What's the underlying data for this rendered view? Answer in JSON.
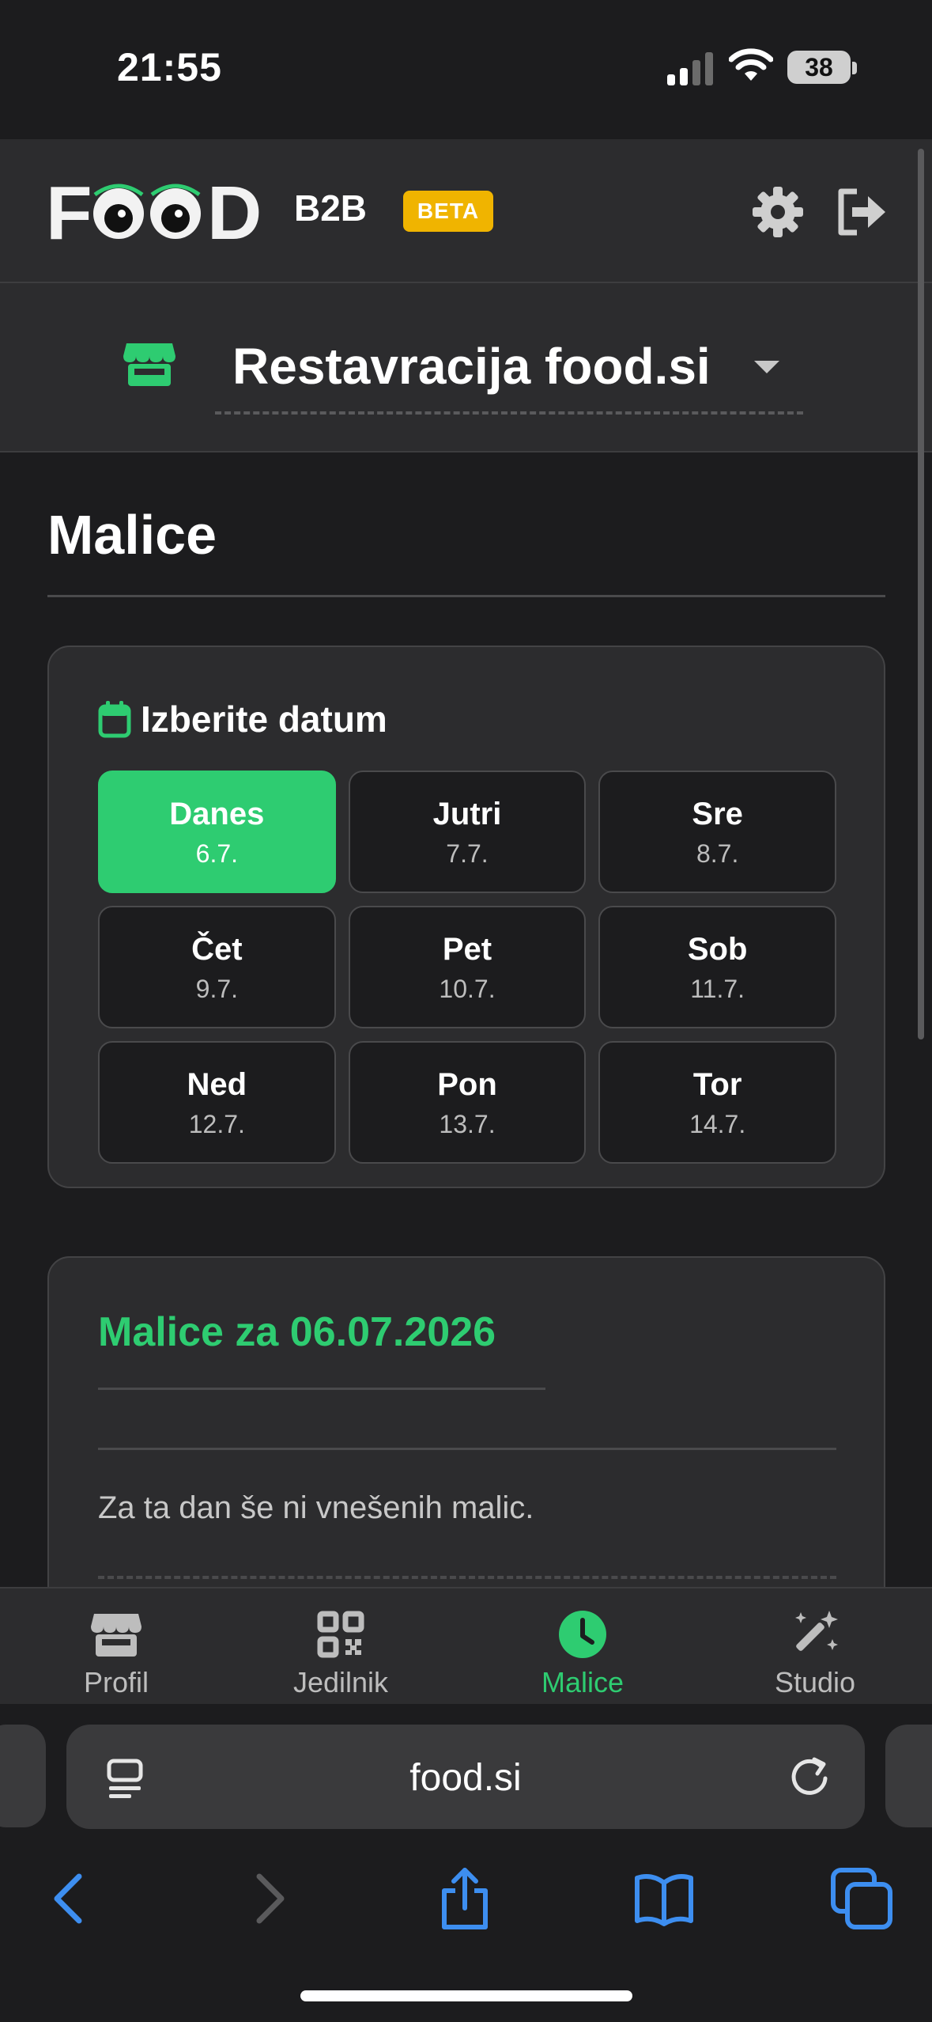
{
  "status_bar": {
    "time": "21:55",
    "battery": "38"
  },
  "header": {
    "brand": "FOOD",
    "suffix": "B2B",
    "badge": "BETA"
  },
  "restaurant": {
    "name": "Restavracija food.si"
  },
  "page": {
    "title": "Malice"
  },
  "date_picker": {
    "title": "Izberite datum",
    "dates": [
      {
        "day": "Danes",
        "date": "6.7.",
        "selected": true
      },
      {
        "day": "Jutri",
        "date": "7.7."
      },
      {
        "day": "Sre",
        "date": "8.7."
      },
      {
        "day": "Čet",
        "date": "9.7."
      },
      {
        "day": "Pet",
        "date": "10.7."
      },
      {
        "day": "Sob",
        "date": "11.7."
      },
      {
        "day": "Ned",
        "date": "12.7."
      },
      {
        "day": "Pon",
        "date": "13.7."
      },
      {
        "day": "Tor",
        "date": "14.7."
      }
    ]
  },
  "meals": {
    "title": "Malice za 06.07.2026",
    "empty_message": "Za ta dan še ni vnešenih malic."
  },
  "tabs": [
    {
      "label": "Profil",
      "icon": "store-icon"
    },
    {
      "label": "Jedilnik",
      "icon": "qr-code-icon"
    },
    {
      "label": "Malice",
      "icon": "clock-icon",
      "active": true
    },
    {
      "label": "Studio",
      "icon": "magic-wand-icon"
    }
  ],
  "browser": {
    "url": "food.si"
  },
  "colors": {
    "accent": "#2ecc71",
    "badge": "#f0b400",
    "background": "#1c1c1e",
    "surface": "#2c2c2e",
    "link_blue": "#3d8ef0"
  }
}
